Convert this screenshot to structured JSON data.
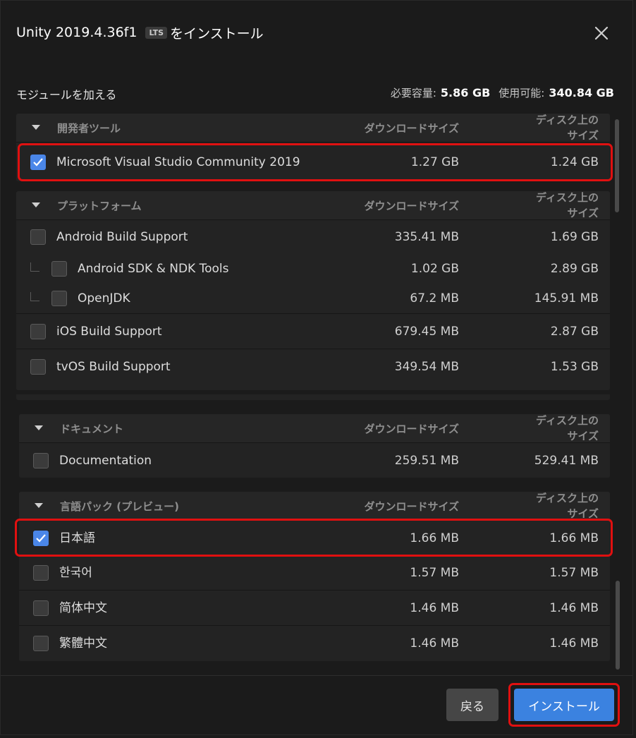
{
  "dialog": {
    "title_prefix": "Unity 2019.4.36f1",
    "lts_badge": "LTS",
    "title_suffix": "をインストール",
    "close_icon": "close-icon"
  },
  "summary": {
    "heading": "モジュールを加える",
    "required_label": "必要容量:",
    "required_value": "5.86 GB",
    "available_label": "使用可能:",
    "available_value": "340.84 GB"
  },
  "columns": {
    "download": "ダウンロードサイズ",
    "disk_line1": "ディスク上の",
    "disk_line2": "サイズ"
  },
  "groups": {
    "devtools": {
      "name": "開発者ツール",
      "items": [
        {
          "label": "Microsoft Visual Studio Community 2019",
          "download": "1.27 GB",
          "disk": "1.24 GB",
          "checked": true
        }
      ]
    },
    "platforms": {
      "name": "プラットフォーム",
      "items": [
        {
          "label": "Android Build Support",
          "download": "335.41 MB",
          "disk": "1.69 GB",
          "checked": false
        },
        {
          "label": "Android SDK & NDK Tools",
          "download": "1.02 GB",
          "disk": "2.89 GB",
          "checked": false
        },
        {
          "label": "OpenJDK",
          "download": "67.2 MB",
          "disk": "145.91 MB",
          "checked": false
        },
        {
          "label": "iOS Build Support",
          "download": "679.45 MB",
          "disk": "2.87 GB",
          "checked": false
        },
        {
          "label": "tvOS Build Support",
          "download": "349.54 MB",
          "disk": "1.53 GB",
          "checked": false
        }
      ]
    },
    "docs": {
      "name": "ドキュメント",
      "items": [
        {
          "label": "Documentation",
          "download": "259.51 MB",
          "disk": "529.41 MB",
          "checked": false
        }
      ]
    },
    "langs": {
      "name": "言語パック (プレビュー)",
      "items": [
        {
          "label": "日本語",
          "download": "1.66 MB",
          "disk": "1.66 MB",
          "checked": true
        },
        {
          "label": "한국어",
          "download": "1.57 MB",
          "disk": "1.57 MB",
          "checked": false
        },
        {
          "label": "简体中文",
          "download": "1.46 MB",
          "disk": "1.46 MB",
          "checked": false
        },
        {
          "label": "繁體中文",
          "download": "1.46 MB",
          "disk": "1.46 MB",
          "checked": false
        }
      ]
    }
  },
  "footer": {
    "back_label": "戻る",
    "install_label": "インストール"
  },
  "colors": {
    "accent": "#3b82e0",
    "highlight": "#e01010",
    "background": "#1b1b1b"
  }
}
